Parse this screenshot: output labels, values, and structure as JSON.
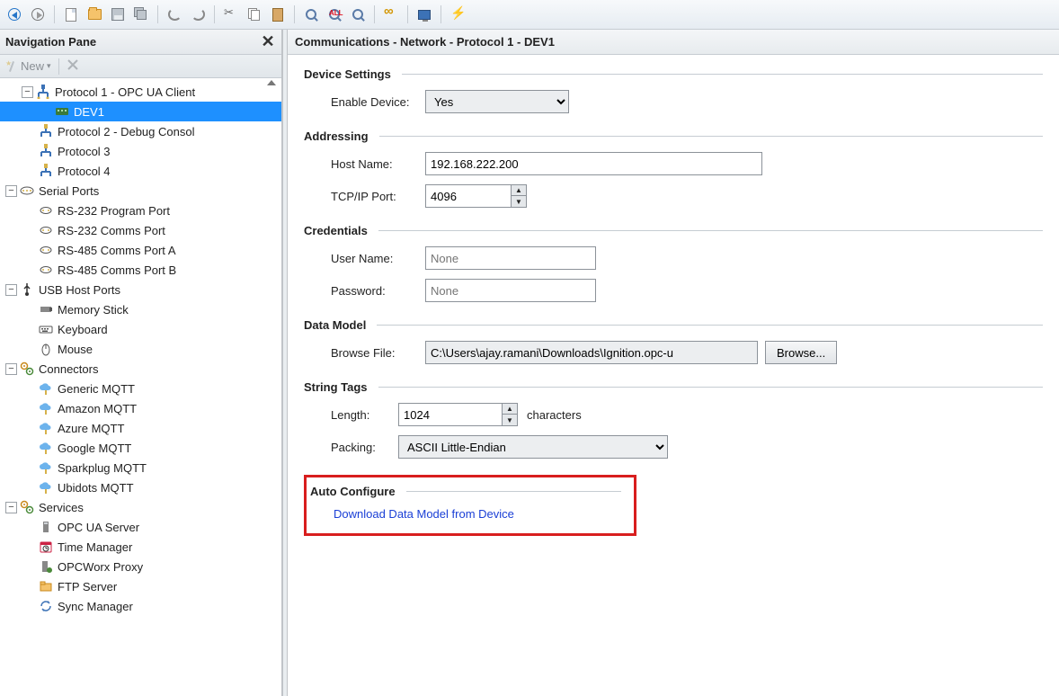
{
  "toolbar": {
    "buttons": [
      {
        "name": "nav-back-button",
        "icon": "back"
      },
      {
        "name": "nav-forward-button",
        "icon": "fwd"
      },
      {
        "name": "sep"
      },
      {
        "name": "new-file-button",
        "icon": "doc"
      },
      {
        "name": "open-file-button",
        "icon": "folder"
      },
      {
        "name": "save-button",
        "icon": "disk"
      },
      {
        "name": "save-all-button",
        "icon": "disks"
      },
      {
        "name": "sep"
      },
      {
        "name": "undo-button",
        "icon": "undo"
      },
      {
        "name": "redo-button",
        "icon": "redo"
      },
      {
        "name": "sep"
      },
      {
        "name": "cut-button",
        "icon": "cut"
      },
      {
        "name": "copy-button",
        "icon": "copy"
      },
      {
        "name": "paste-button",
        "icon": "paste"
      },
      {
        "name": "sep"
      },
      {
        "name": "find-button",
        "icon": "find"
      },
      {
        "name": "find-all-button",
        "icon": "findall"
      },
      {
        "name": "replace-button",
        "icon": "replace"
      },
      {
        "name": "sep"
      },
      {
        "name": "link-button",
        "icon": "link"
      },
      {
        "name": "sep"
      },
      {
        "name": "display-button",
        "icon": "screen"
      },
      {
        "name": "sep"
      },
      {
        "name": "run-button",
        "icon": "zap"
      }
    ]
  },
  "nav": {
    "title": "Navigation Pane",
    "new_label": "New",
    "tree": {
      "protocol1": "Protocol 1 - OPC UA Client",
      "dev1": "DEV1",
      "protocol2": "Protocol 2 - Debug Consol",
      "protocol3": "Protocol 3",
      "protocol4": "Protocol 4",
      "serial_ports": "Serial Ports",
      "rs232_prog": "RS-232 Program Port",
      "rs232_comms": "RS-232 Comms Port",
      "rs485_a": "RS-485 Comms Port A",
      "rs485_b": "RS-485 Comms Port B",
      "usb_host": "USB Host Ports",
      "memory_stick": "Memory Stick",
      "keyboard": "Keyboard",
      "mouse": "Mouse",
      "connectors": "Connectors",
      "generic_mqtt": "Generic MQTT",
      "amazon_mqtt": "Amazon MQTT",
      "azure_mqtt": "Azure MQTT",
      "google_mqtt": "Google MQTT",
      "sparkplug_mqtt": "Sparkplug MQTT",
      "ubidots_mqtt": "Ubidots MQTT",
      "services": "Services",
      "opc_ua_server": "OPC UA Server",
      "time_manager": "Time Manager",
      "opcworx_proxy": "OPCWorx Proxy",
      "ftp_server": "FTP Server",
      "sync_manager": "Sync Manager"
    }
  },
  "content": {
    "title": "Communications - Network - Protocol 1 - DEV1",
    "sections": {
      "device_settings": {
        "title": "Device Settings",
        "enable_device_label": "Enable Device:",
        "enable_device_value": "Yes"
      },
      "addressing": {
        "title": "Addressing",
        "host_name_label": "Host Name:",
        "host_name_value": "192.168.222.200",
        "tcp_port_label": "TCP/IP Port:",
        "tcp_port_value": "4096"
      },
      "credentials": {
        "title": "Credentials",
        "user_name_label": "User Name:",
        "user_name_placeholder": "None",
        "password_label": "Password:",
        "password_placeholder": "None"
      },
      "data_model": {
        "title": "Data Model",
        "browse_file_label": "Browse File:",
        "browse_file_value": "C:\\Users\\ajay.ramani\\Downloads\\Ignition.opc-u",
        "browse_button": "Browse..."
      },
      "string_tags": {
        "title": "String Tags",
        "length_label": "Length:",
        "length_value": "1024",
        "length_units": "characters",
        "packing_label": "Packing:",
        "packing_value": "ASCII Little-Endian"
      },
      "auto_configure": {
        "title": "Auto Configure",
        "download_link": "Download Data Model from Device"
      }
    }
  }
}
